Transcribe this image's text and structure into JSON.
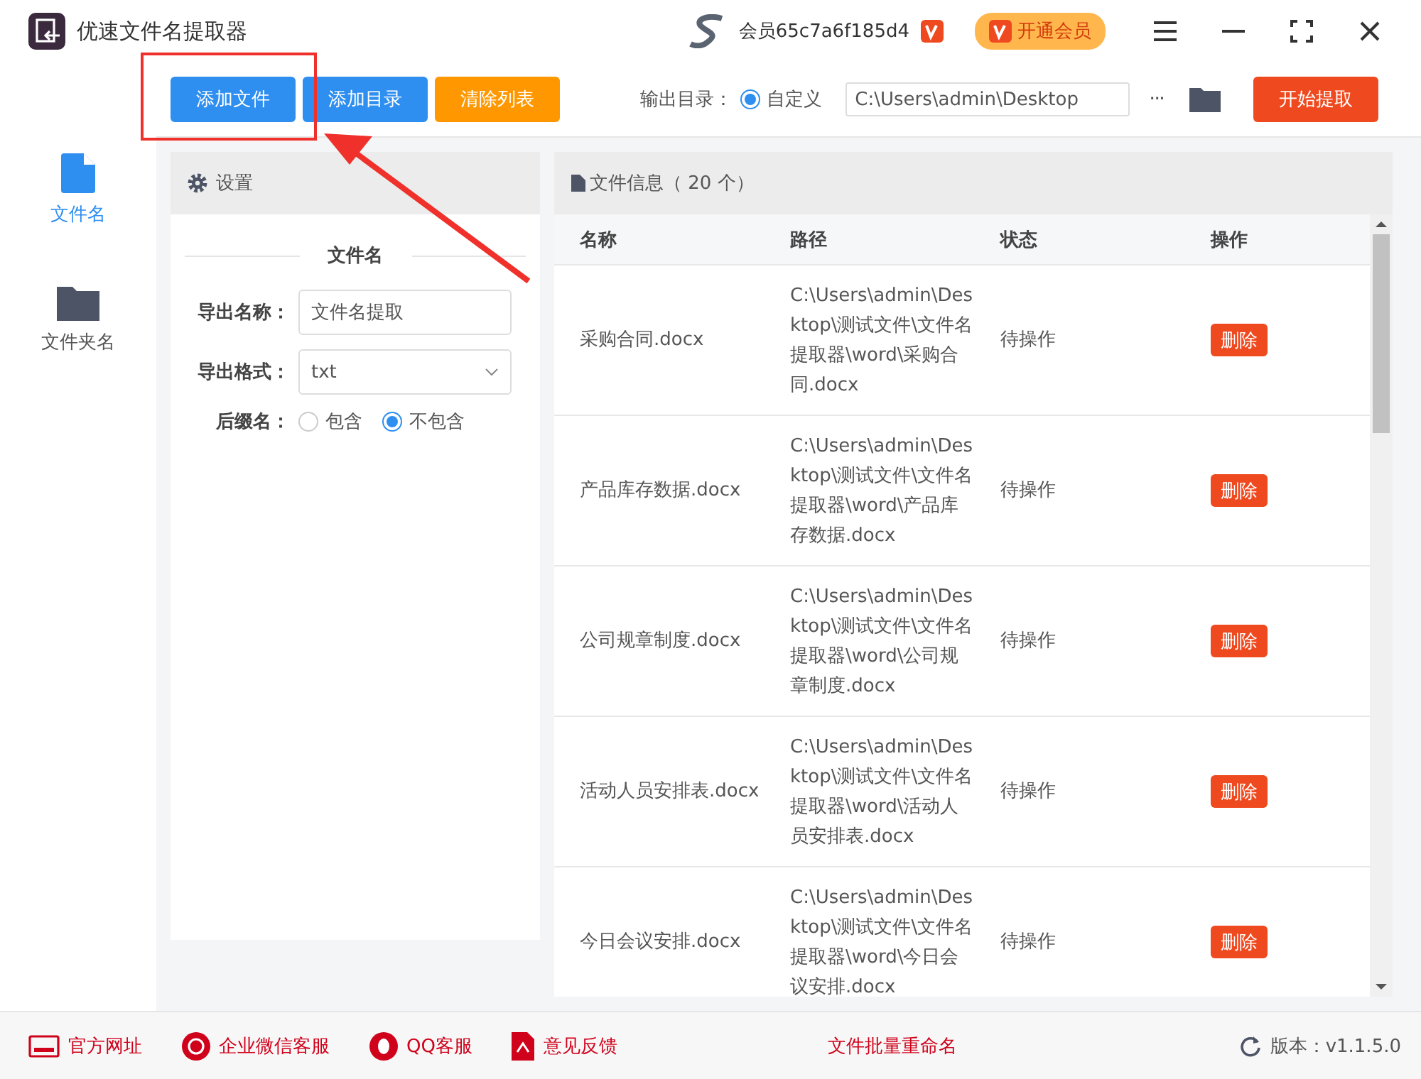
{
  "window": {
    "title": "优速文件名提取器"
  },
  "account": {
    "member": "会员65c7a6f185d4",
    "upgrade": "开通会员"
  },
  "toolbar": {
    "buttons": [
      {
        "label": "添加文件",
        "kind": "primary"
      },
      {
        "label": "添加目录",
        "kind": "primary"
      },
      {
        "label": "清除列表",
        "kind": "warning"
      }
    ],
    "output_label": "输出目录：",
    "radio": {
      "label": "自定义",
      "selected": true
    },
    "path": "C:\\Users\\admin\\Desktop",
    "more": "···",
    "start": "开始提取"
  },
  "sidebar": {
    "items": [
      {
        "label": "文件名",
        "selected": true,
        "kind": "file"
      },
      {
        "label": "文件夹名",
        "selected": false,
        "kind": "folder"
      }
    ]
  },
  "settings": {
    "title": "设置",
    "section": "文件名",
    "name_label": "导出名称：",
    "name_value": "文件名提取",
    "format_label": "导出格式：",
    "format_value": "txt",
    "suffix_label": "后缀名：",
    "suffix_options": [
      {
        "label": "包含",
        "selected": false
      },
      {
        "label": "不包含",
        "selected": true
      }
    ]
  },
  "files": {
    "title": "文件信息（ 20 个）",
    "columns": [
      "名称",
      "路径",
      "状态",
      "操作"
    ],
    "rows": [
      {
        "name": "采购合同.docx",
        "path": "C:\\Users\\admin\\Desktop\\测试文件\\文件名提取器\\word\\采购合同.docx",
        "status": "待操作",
        "action": "删除"
      },
      {
        "name": "产品库存数据.docx",
        "path": "C:\\Users\\admin\\Desktop\\测试文件\\文件名提取器\\word\\产品库存数据.docx",
        "status": "待操作",
        "action": "删除"
      },
      {
        "name": "公司规章制度.docx",
        "path": "C:\\Users\\admin\\Desktop\\测试文件\\文件名提取器\\word\\公司规章制度.docx",
        "status": "待操作",
        "action": "删除"
      },
      {
        "name": "活动人员安排表.docx",
        "path": "C:\\Users\\admin\\Desktop\\测试文件\\文件名提取器\\word\\活动人员安排表.docx",
        "status": "待操作",
        "action": "删除"
      },
      {
        "name": "今日会议安排.docx",
        "path": "C:\\Users\\admin\\Desktop\\测试文件\\文件名提取器\\word\\今日会议安排.docx",
        "status": "待操作",
        "action": "删除"
      }
    ]
  },
  "footer": {
    "links": [
      {
        "label": "官方网址",
        "kind": "web"
      },
      {
        "label": "企业微信客服",
        "kind": "wechat"
      },
      {
        "label": "QQ客服",
        "kind": "qq"
      },
      {
        "label": "意见反馈",
        "kind": "feedback"
      }
    ],
    "center": "文件批量重命名",
    "version": "版本：v1.1.5.0"
  }
}
